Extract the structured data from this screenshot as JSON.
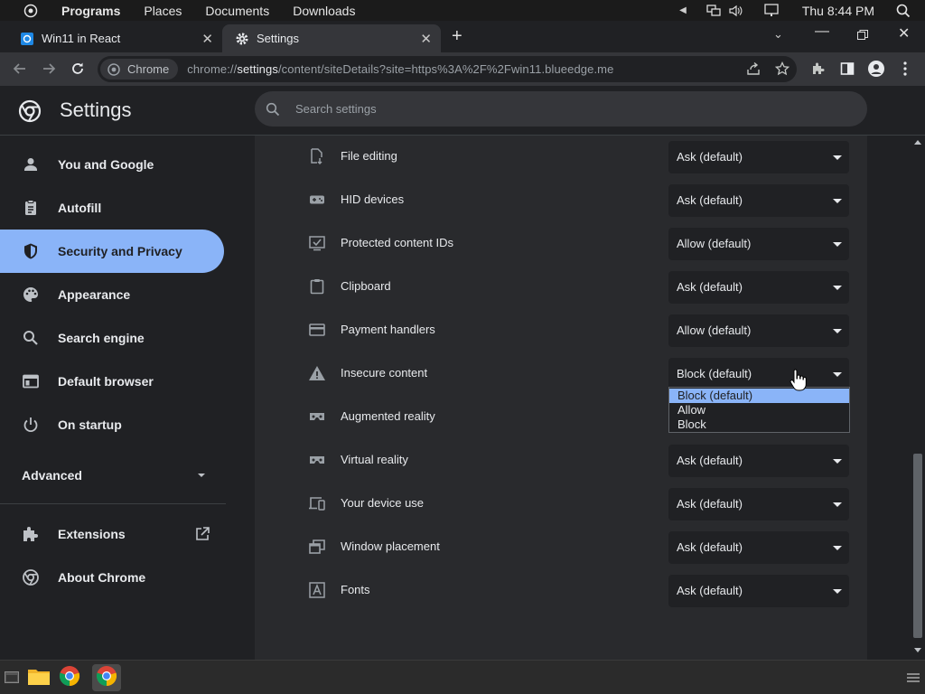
{
  "sysbar": {
    "menus": [
      "Programs",
      "Places",
      "Documents",
      "Downloads"
    ],
    "clock": "Thu 8:44 PM"
  },
  "tabs": [
    {
      "label": "Win11 in React"
    },
    {
      "label": "Settings"
    }
  ],
  "omnibox": {
    "chip": "Chrome",
    "url_prefix": "chrome://",
    "url_host": "settings",
    "url_path": "/content/siteDetails?site=https%3A%2F%2Fwin11.blueedge.me"
  },
  "header": {
    "title": "Settings",
    "search_placeholder": "Search settings"
  },
  "sidebar": {
    "items": [
      {
        "label": "You and Google",
        "icon": "person-icon"
      },
      {
        "label": "Autofill",
        "icon": "clipboard-icon"
      },
      {
        "label": "Security and Privacy",
        "icon": "shield-icon"
      },
      {
        "label": "Appearance",
        "icon": "palette-icon"
      },
      {
        "label": "Search engine",
        "icon": "search-icon"
      },
      {
        "label": "Default browser",
        "icon": "browser-icon"
      },
      {
        "label": "On startup",
        "icon": "power-icon"
      }
    ],
    "advanced": "Advanced",
    "extensions": "Extensions",
    "about": "About Chrome"
  },
  "permissions": [
    {
      "label": "File editing",
      "value": "Ask (default)",
      "icon": "file-edit-icon"
    },
    {
      "label": "HID devices",
      "value": "Ask (default)",
      "icon": "gamepad-icon"
    },
    {
      "label": "Protected content IDs",
      "value": "Allow (default)",
      "icon": "checkbox-icon"
    },
    {
      "label": "Clipboard",
      "value": "Ask (default)",
      "icon": "clipboard-icon"
    },
    {
      "label": "Payment handlers",
      "value": "Allow (default)",
      "icon": "credit-card-icon"
    },
    {
      "label": "Insecure content",
      "value": "Block (default)",
      "icon": "warning-icon"
    },
    {
      "label": "Augmented reality",
      "value": "",
      "icon": "vr-headset-icon"
    },
    {
      "label": "Virtual reality",
      "value": "Ask (default)",
      "icon": "vr-headset-icon"
    },
    {
      "label": "Your device use",
      "value": "Ask (default)",
      "icon": "devices-icon"
    },
    {
      "label": "Window placement",
      "value": "Ask (default)",
      "icon": "window-placement-icon"
    },
    {
      "label": "Fonts",
      "value": "Ask (default)",
      "icon": "font-icon"
    }
  ],
  "dropdown": {
    "options": [
      "Block (default)",
      "Allow",
      "Block"
    ],
    "highlighted": "Block (default)"
  },
  "colors": {
    "accent": "#8ab4f8",
    "background": "#202124",
    "card": "#292a2d"
  }
}
